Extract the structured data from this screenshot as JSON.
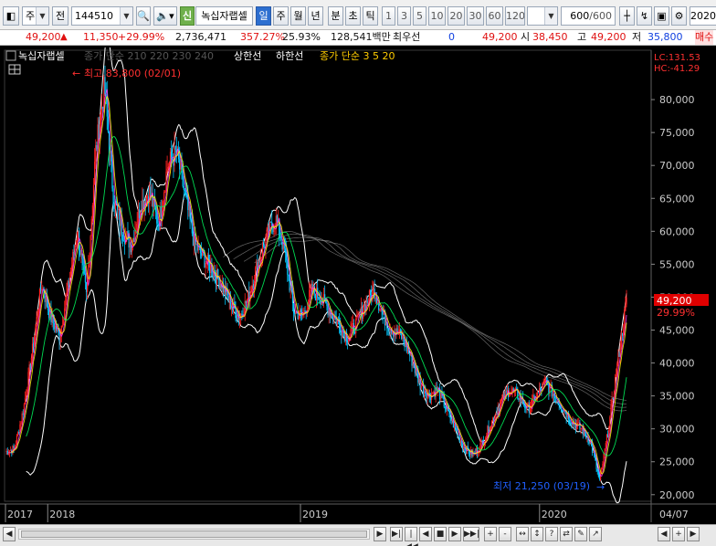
{
  "toolbar": {
    "market_select": "주",
    "prev_label": "전",
    "code_input": "144510",
    "new_badge": "신",
    "stock_name": "녹십자랩셀",
    "periods": [
      "일",
      "주",
      "월",
      "년",
      "분",
      "초",
      "틱"
    ],
    "active_period": "일",
    "intervals": [
      "1",
      "3",
      "5",
      "10",
      "20",
      "30",
      "60",
      "120"
    ],
    "count_value": "600",
    "count_total": "/600",
    "year_value": "2020"
  },
  "quote": {
    "price": "49,200",
    "change": "11,350",
    "change_pct": "+29.99%",
    "volume": "2,736,471",
    "volume_ratio": "357.27%",
    "turnover": "25.93%",
    "amount": "128,541백만",
    "priority_label": "최우선",
    "priority_value": "0",
    "current": "49,200",
    "open_label": "시",
    "open": "38,450",
    "high_label": "고",
    "high": "49,200",
    "low_label": "저",
    "low": "35,800",
    "sell_label": "매수"
  },
  "chart": {
    "legend_title": "녹십자랩셀",
    "legend_ma_long": "종가 단순 210 220 230 240",
    "legend_upper": "상한선",
    "legend_lower": "하한선",
    "legend_ma_short": "종가 단순 3 5 20",
    "lc_label": "LC:131.53",
    "hc_label": "HC:-41.29",
    "max_label": "최고 83,800 (02/01)",
    "min_label": "최저 21,250 (03/19)",
    "last_price_tag": "49,200",
    "last_pct_tag": "29.99%",
    "x_axis_end": "04/07"
  },
  "chart_data": {
    "type": "candlestick",
    "y_ticks": [
      "80,000",
      "75,000",
      "70,000",
      "65,000",
      "60,000",
      "55,000",
      "50,000",
      "45,000",
      "40,000",
      "35,000",
      "30,000",
      "25,000",
      "20,000"
    ],
    "ylim": [
      19000,
      87500
    ],
    "x_ticks": [
      "2017",
      "2018",
      "2019",
      "2020"
    ],
    "series": [
      {
        "name": "close",
        "values": [
          26500,
          27000,
          33000,
          42000,
          52000,
          47000,
          44000,
          52000,
          60000,
          50000,
          72000,
          82000,
          65000,
          60000,
          58000,
          64000,
          66000,
          61000,
          70000,
          72000,
          65000,
          58000,
          56000,
          54000,
          52000,
          49000,
          47000,
          50000,
          55000,
          59000,
          62000,
          57000,
          48000,
          47000,
          51000,
          50000,
          48000,
          46000,
          44000,
          46000,
          49000,
          51000,
          47000,
          45000,
          44000,
          41000,
          37000,
          35000,
          36000,
          33000,
          30000,
          27000,
          26000,
          28000,
          31000,
          34000,
          36000,
          35000,
          33000,
          35000,
          37000,
          35000,
          33000,
          31000,
          30000,
          28000,
          22000,
          30000,
          40000,
          49200
        ]
      }
    ],
    "max_point": {
      "label": "최고",
      "value": 83800,
      "date": "02/01"
    },
    "min_point": {
      "label": "최저",
      "value": 21250,
      "date": "03/19"
    },
    "last_value": 49200,
    "last_change_pct": 29.99,
    "colors": {
      "up": "#ff2020",
      "down": "#00c8ff",
      "ma3": "#ff40ff",
      "ma5": "#ffff00",
      "ma20": "#00ff60",
      "bands": "#ffffff",
      "ma_long": "#909090"
    }
  },
  "statusbar": {
    "buttons": [
      "◀",
      "▶",
      "▶|",
      "|◀◀",
      "◀",
      "■",
      "▶",
      "▶▶|",
      "+",
      "-",
      "↔",
      "↕",
      "?",
      "⇄",
      "✎",
      "↗",
      "◀",
      "+",
      "▶"
    ]
  }
}
